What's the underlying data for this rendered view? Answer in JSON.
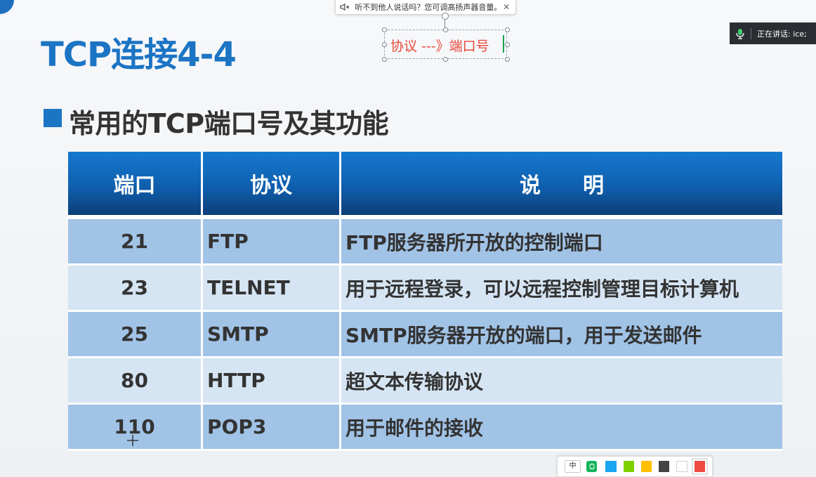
{
  "notification": {
    "text": "听不到他人说话吗？您可调高扬声器音量。",
    "close_glyph": "✕"
  },
  "slide": {
    "title": "TCP连接4-4",
    "section_heading": "常用的TCP端口号及其功能"
  },
  "annotation": {
    "text": "协议 ---》端口号",
    "color": "#e9473a"
  },
  "speaking": {
    "label": "正在讲话:  ice;"
  },
  "table": {
    "headers": [
      "端口",
      "协议",
      "说　　明"
    ],
    "rows": [
      {
        "port": "21",
        "protocol": "FTP",
        "description": "FTP服务器所开放的控制端口"
      },
      {
        "port": "23",
        "protocol": "TELNET",
        "description": "用于远程登录，可以远程控制管理目标计算机"
      },
      {
        "port": "25",
        "protocol": "SMTP",
        "description": "SMTP服务器开放的端口，用于发送邮件"
      },
      {
        "port": "80",
        "protocol": "HTTP",
        "description": "超文本传输协议"
      },
      {
        "port": "110",
        "protocol": "POP3",
        "description": "用于邮件的接收"
      }
    ]
  },
  "palette": {
    "ime_label": "中",
    "swatches": [
      "#1aa6f0",
      "#7fd000",
      "#ffc000",
      "#444444",
      "#ffffff",
      "#f04a45"
    ],
    "selected_index": 5
  },
  "colors": {
    "title_blue": "#1c74c4",
    "header_blue": "#0f5fae",
    "row_dark": "#a1c3e6",
    "row_light": "#d6e5f3"
  }
}
